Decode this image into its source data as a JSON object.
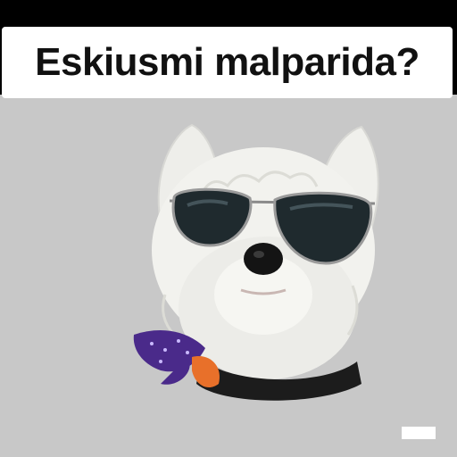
{
  "caption": {
    "text": "Eskiusmi malparida?"
  },
  "sticker": {
    "icon": "dog-with-sunglasses-icon"
  },
  "colors": {
    "background_top": "#000000",
    "background": "#c8c8c8",
    "caption_box": "#ffffff",
    "caption_text": "#111111",
    "bandana_purple": "#4a2a8a",
    "bandana_orange": "#e8702a"
  }
}
